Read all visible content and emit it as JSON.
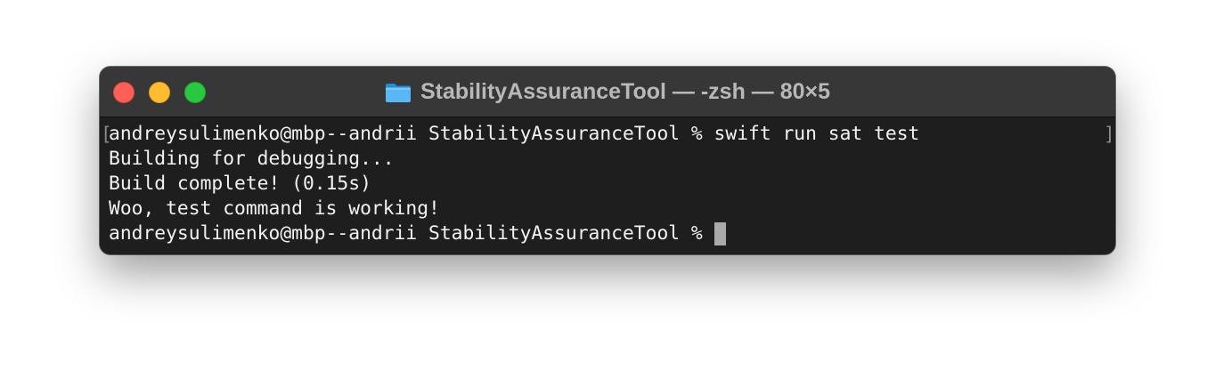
{
  "window": {
    "title": "StabilityAssuranceTool — -zsh — 80×5",
    "title_icon": "folder-icon",
    "traffic_lights": {
      "close_color": "#ff5f57",
      "minimize_color": "#febc2e",
      "zoom_color": "#28c840"
    }
  },
  "terminal": {
    "lines": [
      "andreysulimenko@mbp--andrii StabilityAssuranceTool % swift run sat test",
      "Building for debugging...",
      "Build complete! (0.15s)",
      "Woo, test command is working!"
    ],
    "prompt": "andreysulimenko@mbp--andrii StabilityAssuranceTool % ",
    "background_color": "#1e1e1e",
    "text_color": "#f2f2f2"
  }
}
